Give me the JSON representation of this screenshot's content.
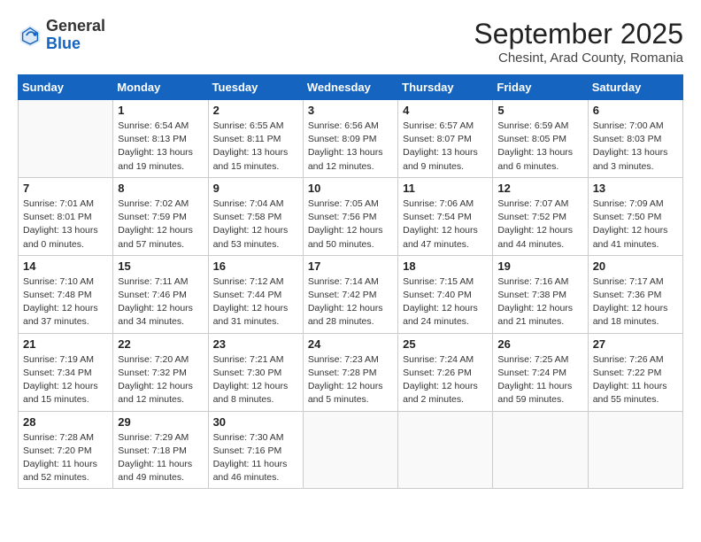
{
  "header": {
    "logo_general": "General",
    "logo_blue": "Blue",
    "month_title": "September 2025",
    "location": "Chesint, Arad County, Romania"
  },
  "days_of_week": [
    "Sunday",
    "Monday",
    "Tuesday",
    "Wednesday",
    "Thursday",
    "Friday",
    "Saturday"
  ],
  "weeks": [
    [
      {
        "day": "",
        "info": ""
      },
      {
        "day": "1",
        "info": "Sunrise: 6:54 AM\nSunset: 8:13 PM\nDaylight: 13 hours\nand 19 minutes."
      },
      {
        "day": "2",
        "info": "Sunrise: 6:55 AM\nSunset: 8:11 PM\nDaylight: 13 hours\nand 15 minutes."
      },
      {
        "day": "3",
        "info": "Sunrise: 6:56 AM\nSunset: 8:09 PM\nDaylight: 13 hours\nand 12 minutes."
      },
      {
        "day": "4",
        "info": "Sunrise: 6:57 AM\nSunset: 8:07 PM\nDaylight: 13 hours\nand 9 minutes."
      },
      {
        "day": "5",
        "info": "Sunrise: 6:59 AM\nSunset: 8:05 PM\nDaylight: 13 hours\nand 6 minutes."
      },
      {
        "day": "6",
        "info": "Sunrise: 7:00 AM\nSunset: 8:03 PM\nDaylight: 13 hours\nand 3 minutes."
      }
    ],
    [
      {
        "day": "7",
        "info": "Sunrise: 7:01 AM\nSunset: 8:01 PM\nDaylight: 13 hours\nand 0 minutes."
      },
      {
        "day": "8",
        "info": "Sunrise: 7:02 AM\nSunset: 7:59 PM\nDaylight: 12 hours\nand 57 minutes."
      },
      {
        "day": "9",
        "info": "Sunrise: 7:04 AM\nSunset: 7:58 PM\nDaylight: 12 hours\nand 53 minutes."
      },
      {
        "day": "10",
        "info": "Sunrise: 7:05 AM\nSunset: 7:56 PM\nDaylight: 12 hours\nand 50 minutes."
      },
      {
        "day": "11",
        "info": "Sunrise: 7:06 AM\nSunset: 7:54 PM\nDaylight: 12 hours\nand 47 minutes."
      },
      {
        "day": "12",
        "info": "Sunrise: 7:07 AM\nSunset: 7:52 PM\nDaylight: 12 hours\nand 44 minutes."
      },
      {
        "day": "13",
        "info": "Sunrise: 7:09 AM\nSunset: 7:50 PM\nDaylight: 12 hours\nand 41 minutes."
      }
    ],
    [
      {
        "day": "14",
        "info": "Sunrise: 7:10 AM\nSunset: 7:48 PM\nDaylight: 12 hours\nand 37 minutes."
      },
      {
        "day": "15",
        "info": "Sunrise: 7:11 AM\nSunset: 7:46 PM\nDaylight: 12 hours\nand 34 minutes."
      },
      {
        "day": "16",
        "info": "Sunrise: 7:12 AM\nSunset: 7:44 PM\nDaylight: 12 hours\nand 31 minutes."
      },
      {
        "day": "17",
        "info": "Sunrise: 7:14 AM\nSunset: 7:42 PM\nDaylight: 12 hours\nand 28 minutes."
      },
      {
        "day": "18",
        "info": "Sunrise: 7:15 AM\nSunset: 7:40 PM\nDaylight: 12 hours\nand 24 minutes."
      },
      {
        "day": "19",
        "info": "Sunrise: 7:16 AM\nSunset: 7:38 PM\nDaylight: 12 hours\nand 21 minutes."
      },
      {
        "day": "20",
        "info": "Sunrise: 7:17 AM\nSunset: 7:36 PM\nDaylight: 12 hours\nand 18 minutes."
      }
    ],
    [
      {
        "day": "21",
        "info": "Sunrise: 7:19 AM\nSunset: 7:34 PM\nDaylight: 12 hours\nand 15 minutes."
      },
      {
        "day": "22",
        "info": "Sunrise: 7:20 AM\nSunset: 7:32 PM\nDaylight: 12 hours\nand 12 minutes."
      },
      {
        "day": "23",
        "info": "Sunrise: 7:21 AM\nSunset: 7:30 PM\nDaylight: 12 hours\nand 8 minutes."
      },
      {
        "day": "24",
        "info": "Sunrise: 7:23 AM\nSunset: 7:28 PM\nDaylight: 12 hours\nand 5 minutes."
      },
      {
        "day": "25",
        "info": "Sunrise: 7:24 AM\nSunset: 7:26 PM\nDaylight: 12 hours\nand 2 minutes."
      },
      {
        "day": "26",
        "info": "Sunrise: 7:25 AM\nSunset: 7:24 PM\nDaylight: 11 hours\nand 59 minutes."
      },
      {
        "day": "27",
        "info": "Sunrise: 7:26 AM\nSunset: 7:22 PM\nDaylight: 11 hours\nand 55 minutes."
      }
    ],
    [
      {
        "day": "28",
        "info": "Sunrise: 7:28 AM\nSunset: 7:20 PM\nDaylight: 11 hours\nand 52 minutes."
      },
      {
        "day": "29",
        "info": "Sunrise: 7:29 AM\nSunset: 7:18 PM\nDaylight: 11 hours\nand 49 minutes."
      },
      {
        "day": "30",
        "info": "Sunrise: 7:30 AM\nSunset: 7:16 PM\nDaylight: 11 hours\nand 46 minutes."
      },
      {
        "day": "",
        "info": ""
      },
      {
        "day": "",
        "info": ""
      },
      {
        "day": "",
        "info": ""
      },
      {
        "day": "",
        "info": ""
      }
    ]
  ]
}
